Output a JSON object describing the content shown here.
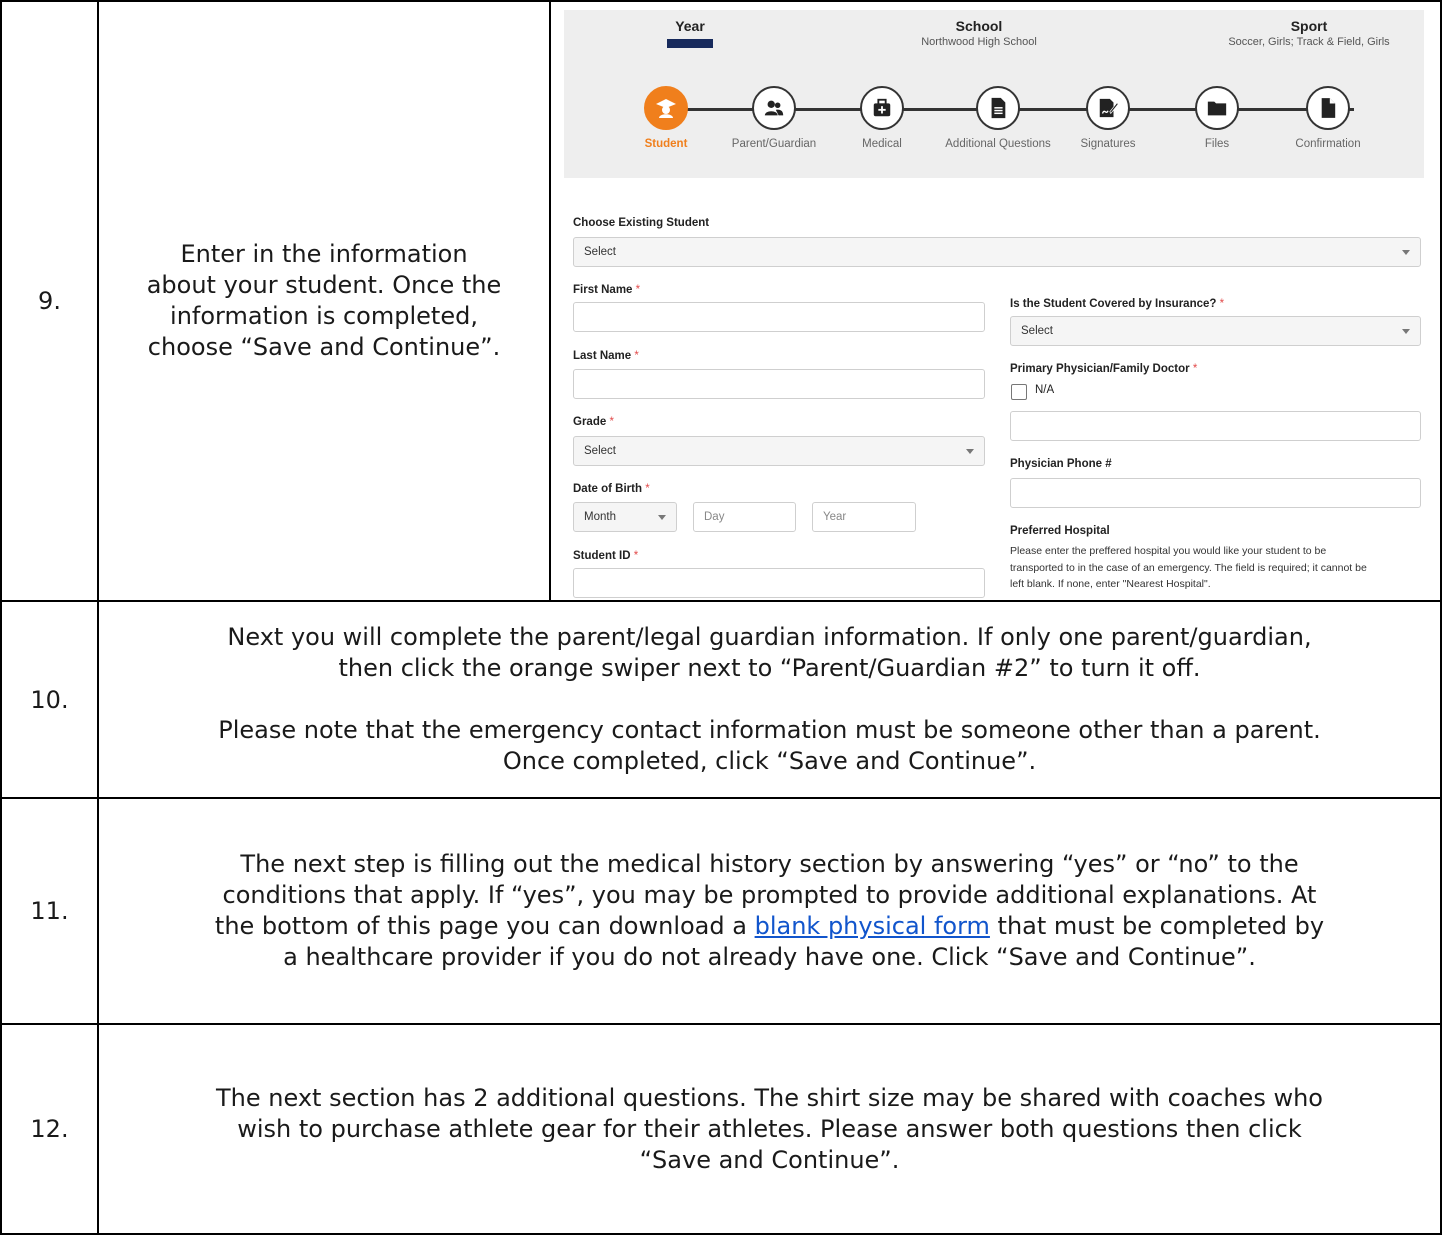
{
  "rows": [
    {
      "number": "9.",
      "lines": [
        "Enter in the information",
        "about your student. Once the",
        "information is completed,",
        "choose “Save and Continue”."
      ]
    },
    {
      "number": "10.",
      "para1_lines": [
        "Next you will complete the parent/legal guardian information. If only one parent/guardian,",
        "then click the orange swiper next to “Parent/Guardian #2” to turn it off."
      ],
      "para2_lines": [
        "Please note that the emergency contact information must be someone other than a parent.",
        "Once completed, click “Save and Continue”."
      ]
    },
    {
      "number": "11.",
      "line1": "The next step is filling out the medical history section by answering “yes” or “no” to the",
      "line2": "conditions that apply. If “yes”, you may be prompted to provide additional explanations. At",
      "line3_before": "the bottom of this page you can download a ",
      "link_text": "blank physical form",
      "line3_after": " that must be completed by",
      "line4": "a healthcare provider if you do not already have one. Click “Save and Continue”."
    },
    {
      "number": "12.",
      "lines": [
        "The next section has 2 additional questions. The shirt size may be shared with coaches who",
        "wish to purchase athlete gear for their athletes. Please answer both questions then click",
        "“Save and Continue”."
      ]
    }
  ],
  "screenshot": {
    "header": {
      "year_title": "Year",
      "school_title": "School",
      "school_value": "Northwood High School",
      "sport_title": "Sport",
      "sport_value": "Soccer, Girls; Track & Field, Girls"
    },
    "steps": [
      {
        "label": "Student",
        "icon": "graduate-icon"
      },
      {
        "label": "Parent/Guardian",
        "icon": "users-icon"
      },
      {
        "label": "Medical",
        "icon": "medkit-icon"
      },
      {
        "label": "Additional Questions",
        "icon": "document-icon"
      },
      {
        "label": "Signatures",
        "icon": "signature-icon"
      },
      {
        "label": "Files",
        "icon": "folder-icon"
      },
      {
        "label": "Confirmation",
        "icon": "file-icon"
      }
    ],
    "form": {
      "choose_existing_label": "Choose Existing Student",
      "choose_existing_value": "Select",
      "first_name_label": "First Name",
      "last_name_label": "Last Name",
      "grade_label": "Grade",
      "grade_value": "Select",
      "dob_label": "Date of Birth",
      "dob_month": "Month",
      "dob_day": "Day",
      "dob_year": "Year",
      "student_id_label": "Student ID",
      "insurance_label": "Is the Student Covered by Insurance?",
      "insurance_value": "Select",
      "physician_label": "Primary Physician/Family Doctor",
      "na_label": "N/A",
      "physician_phone_label": "Physician Phone #",
      "hospital_label": "Preferred Hospital",
      "hospital_help_lines": [
        "Please enter the preffered hospital you would like your student to be",
        "transported to in the case of an emergency. The field is required; it cannot be",
        "left blank. If none, enter \"Nearest Hospital\"."
      ],
      "required_mark": "*"
    },
    "colors": {
      "accent": "#f07f1c",
      "year_bar": "#172a5c"
    }
  }
}
